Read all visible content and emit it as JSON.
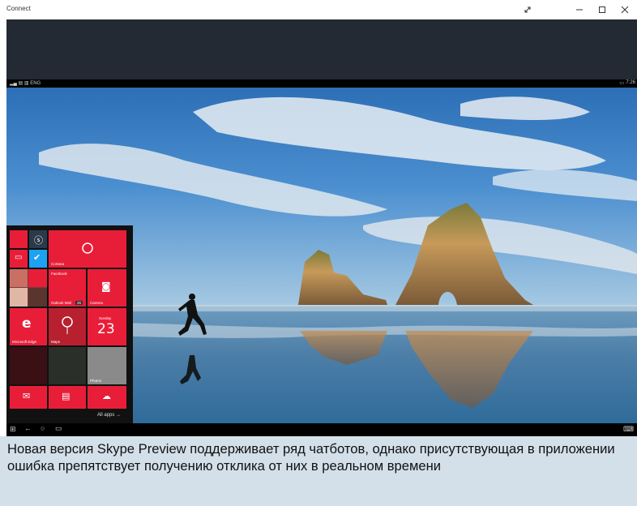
{
  "window": {
    "title": "Connect"
  },
  "status_bar": {
    "left": "▂▄ ▤ ▥ ENG",
    "time": "7:26"
  },
  "start_menu": {
    "tiles": {
      "cortana": "Cortana",
      "outlook": "Outlook Mail",
      "outlook_badge": "26",
      "camera": "Camera",
      "edge": "Microsoft Edge",
      "maps": "Maps",
      "calendar_day": "Sunday",
      "calendar_date": "23",
      "photos": "Photos",
      "facebook": "Facebook"
    },
    "all_apps": "All apps"
  },
  "caption": {
    "text": "Новая версия Skype Preview поддерживает ряд чатботов, однако присутствующая в приложении ошибка препятствует получению отклика от них в реальном времени"
  }
}
